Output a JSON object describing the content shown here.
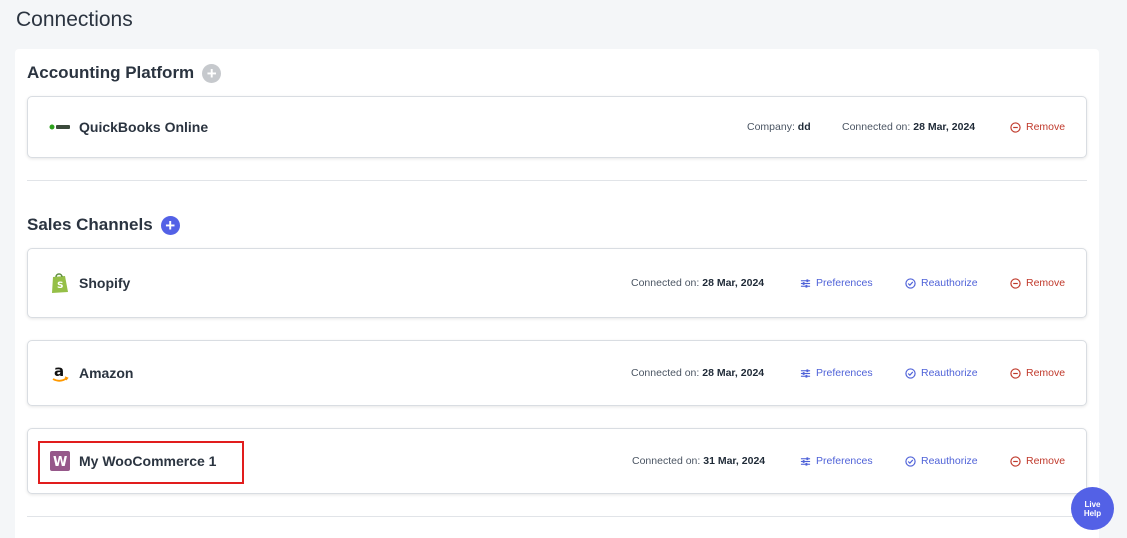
{
  "page": {
    "title": "Connections"
  },
  "accounting": {
    "heading": "Accounting Platform",
    "card": {
      "name": "QuickBooks Online",
      "company_label": "Company:",
      "company_value": "dd",
      "connected_label": "Connected on:",
      "connected_value": "28 Mar, 2024",
      "remove_label": "Remove"
    }
  },
  "sales": {
    "heading": "Sales Channels",
    "cards": [
      {
        "name": "Shopify",
        "connected_label": "Connected on:",
        "connected_value": "28 Mar, 2024",
        "preferences_label": "Preferences",
        "reauthorize_label": "Reauthorize",
        "remove_label": "Remove"
      },
      {
        "name": "Amazon",
        "connected_label": "Connected on:",
        "connected_value": "28 Mar, 2024",
        "preferences_label": "Preferences",
        "reauthorize_label": "Reauthorize",
        "remove_label": "Remove"
      },
      {
        "name": "My WooCommerce 1",
        "connected_label": "Connected on:",
        "connected_value": "31 Mar, 2024",
        "preferences_label": "Preferences",
        "reauthorize_label": "Reauthorize",
        "remove_label": "Remove"
      }
    ]
  },
  "live_help": {
    "line1": "Live",
    "line2": "Help"
  },
  "colors": {
    "accent": "#5361e6",
    "remove": "#c0392b",
    "highlight": "#e11d1d"
  },
  "icons": {
    "add": "plus-circle-icon",
    "preferences": "sliders-icon",
    "reauthorize": "check-circle-icon",
    "remove": "minus-circle-icon"
  }
}
